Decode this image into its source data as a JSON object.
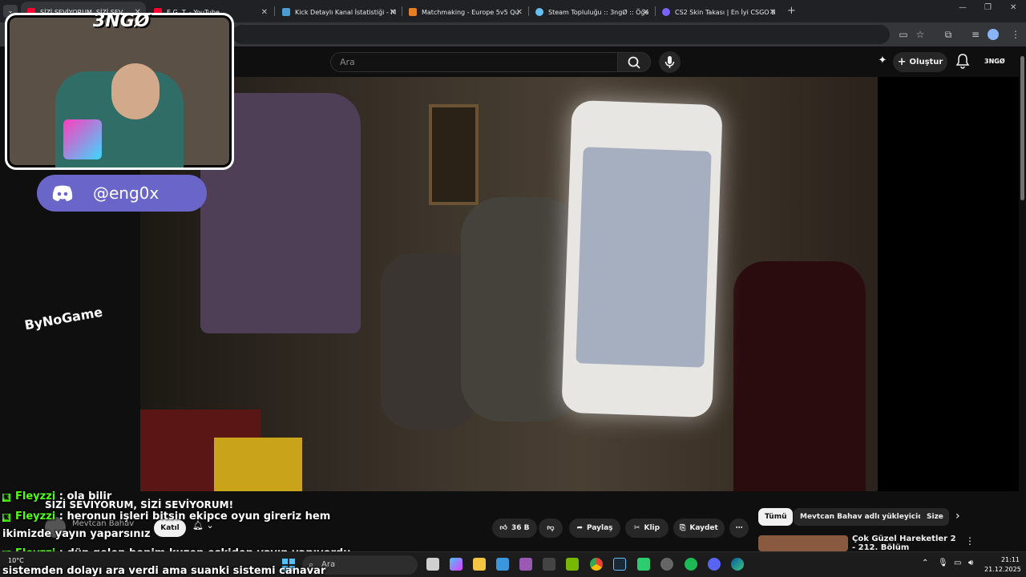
{
  "tabs": [
    {
      "label": "SİZİ SEVİYORUM, SİZİ SEV",
      "active": true,
      "color": "#ff0033"
    },
    {
      "label": "E.G. T. - YouTube",
      "active": false,
      "color": "#ff0033"
    },
    {
      "label": "Kick Detaylı Kanal İstatistiği - M",
      "active": false,
      "color": "#4b9cd3"
    },
    {
      "label": "Matchmaking - Europe 5v5 Qu",
      "active": false,
      "color": "#e67e22"
    },
    {
      "label": "Steam Topluluğu :: 3ngØ :: Öğe",
      "active": false,
      "color": "#66c0f4"
    },
    {
      "label": "CS2 Skin Takası | En İyi CSGO B",
      "active": false,
      "color": "#7b61ff"
    }
  ],
  "search": {
    "placeholder": "Ara"
  },
  "header": {
    "create_label": "Oluştur",
    "avatar_label": "3NGØ"
  },
  "overlay": {
    "cam_logo": "3NGØ",
    "discord_handle": "@eng0x",
    "sponsor_logo": "ByNoGame"
  },
  "video": {
    "title": "SİZİ SEVİYORUM, SİZİ SEVİYORUM!",
    "channel": "Mevtcan Bahav",
    "subscribe_label": "Katıl",
    "likes": "36 B",
    "share": "Paylaş",
    "clip": "Klip",
    "save": "Kaydet"
  },
  "chat": [
    {
      "user": "Fleyzzi",
      "text": " : ola bilir"
    },
    {
      "user": "Fleyzzi",
      "text": " : heronun işleri bitsin ekipce oyun gireriz hem"
    },
    {
      "user": "",
      "text": "ikimizde yayın yaparsınız"
    },
    {
      "user": "Fleyzzi",
      "text": " : dün gelen benim kuzen eskiden yayın yapıyordu"
    },
    {
      "user": "",
      "text": "sistemden dolayı ara verdi ama suanki sistemi canavar"
    }
  ],
  "chips": [
    "Tümü",
    "Mevtcan Bahav adlı yükleyiciden",
    "Size"
  ],
  "recommended": {
    "title": "Çok Güzel Hareketler 2 - 212. Bölüm"
  },
  "taskbar": {
    "search_placeholder": "Ara",
    "time": "21:11",
    "date": "21.12.2025",
    "weather_temp": "10°C"
  }
}
